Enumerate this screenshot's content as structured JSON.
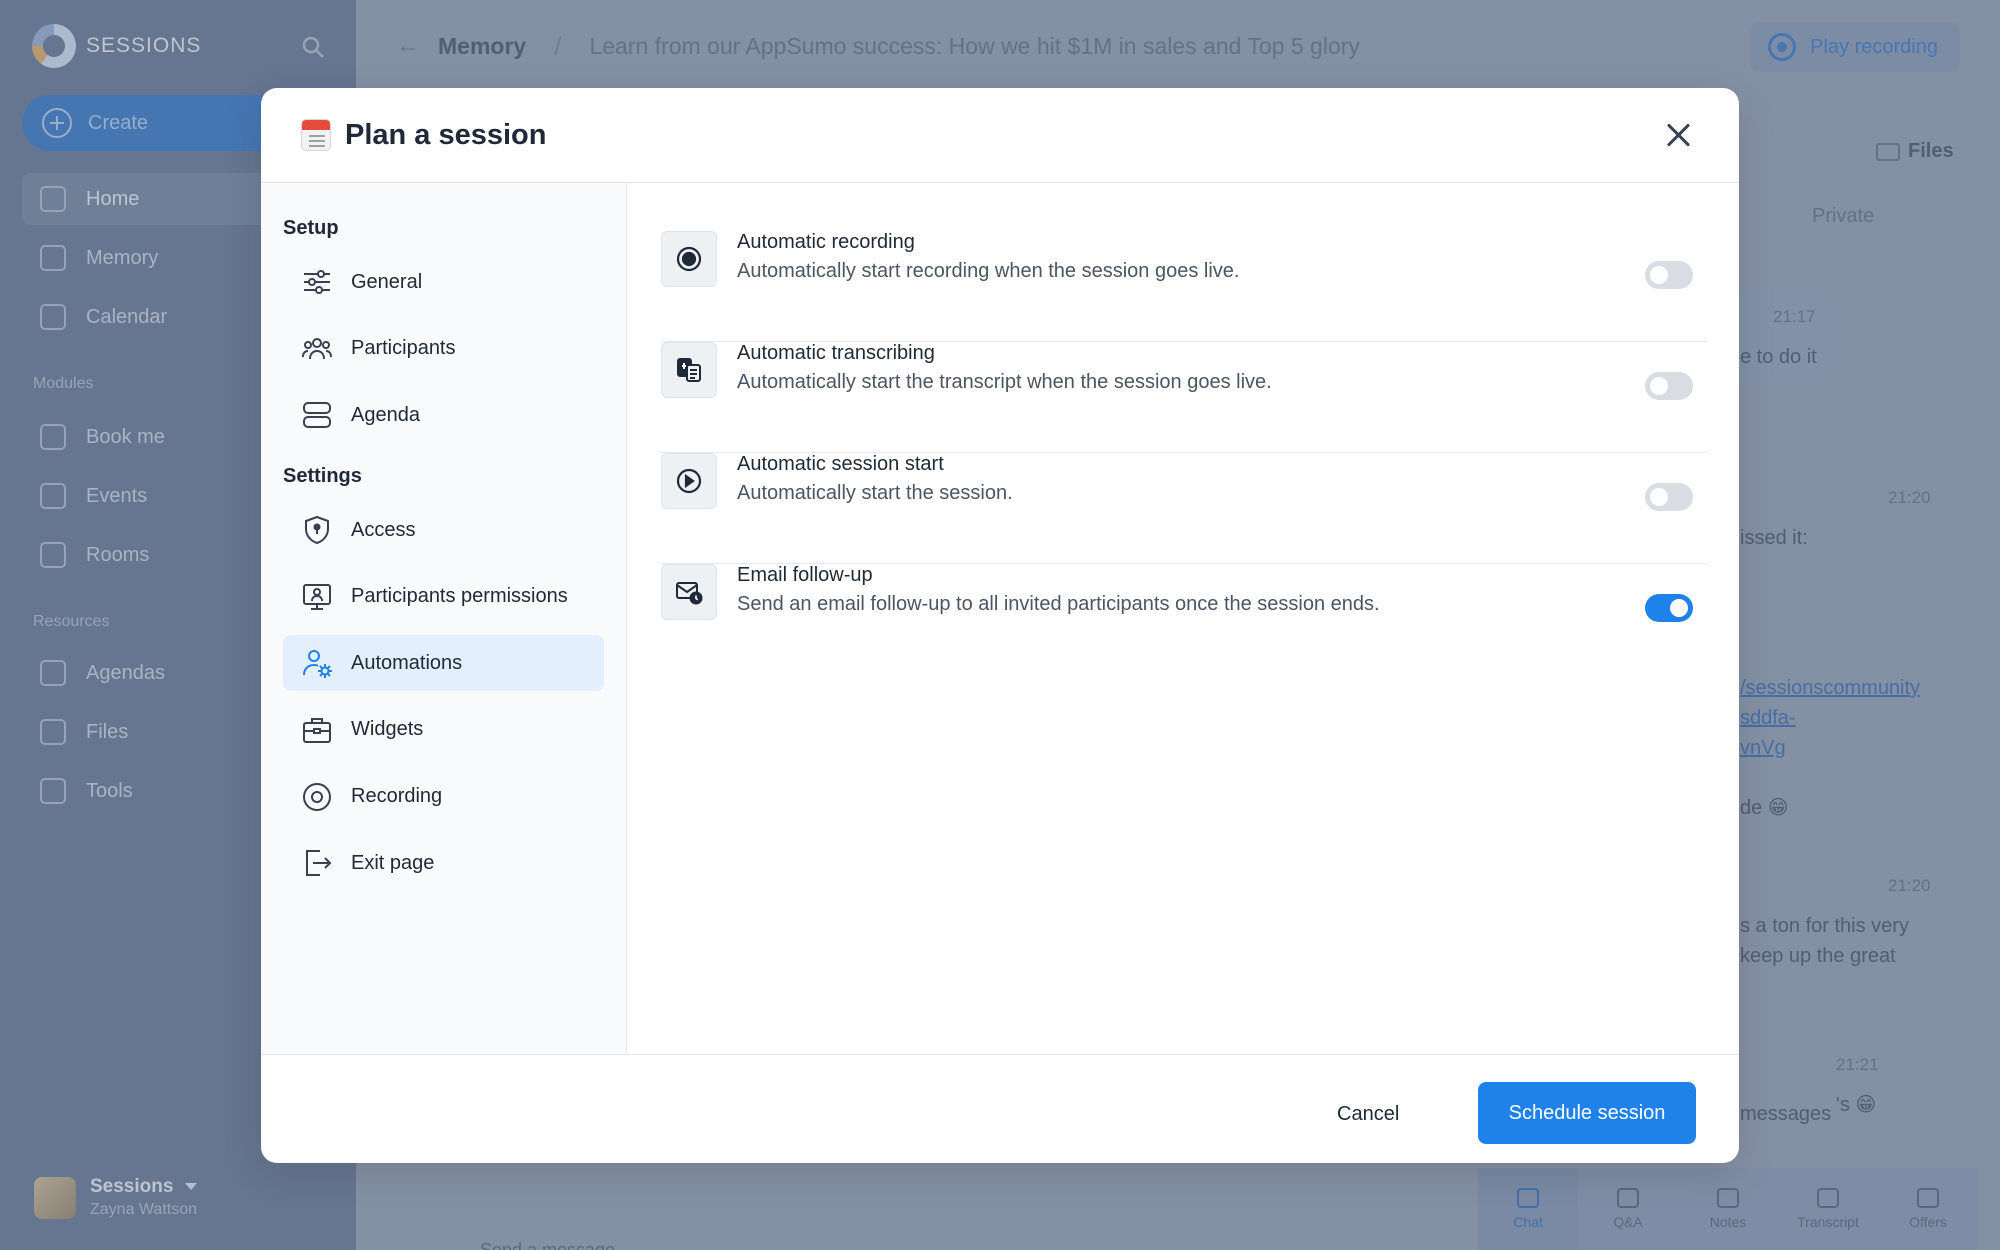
{
  "app": {
    "brand": "SESSIONS",
    "create_label": "Create",
    "nav": {
      "home": "Home",
      "memory": "Memory",
      "calendar": "Calendar",
      "modules_title": "Modules",
      "book_me": "Book me",
      "events": "Events",
      "rooms": "Rooms",
      "resources_title": "Resources",
      "agendas": "Agendas",
      "files": "Files",
      "tools": "Tools"
    },
    "user": {
      "workspace": "Sessions",
      "name": "Zayna Wattson"
    }
  },
  "topbar": {
    "breadcrumb_root": "Memory",
    "breadcrumb_separator": "/",
    "session_title": "Learn from our AppSumo success: How we hit $1M in sales and Top 5 glory",
    "play_recording": "Play recording"
  },
  "right_panel": {
    "files": "Files",
    "private_tab": "Private",
    "messages": [
      {
        "time": "21:17",
        "text": "e to do it"
      },
      {
        "time": "21:20",
        "text": "issed it:",
        "links": [
          "/sessionscommunity",
          "sddfa-",
          "vnVg"
        ],
        "tail": "de 😁"
      },
      {
        "time": "21:20",
        "lines": [
          "s a ton for this very",
          "keep up the great"
        ]
      },
      {
        "time": "21:21",
        "text": "'s 😁"
      }
    ],
    "new_messages": "messages",
    "tabs": [
      "Chat",
      "Q&A",
      "Notes",
      "Transcript",
      "Offers"
    ],
    "active_tab": "Chat",
    "chat_peek": "Send a message"
  },
  "modal": {
    "title": "Plan a session",
    "setup_title": "Setup",
    "settings_title": "Settings",
    "setup_items": [
      {
        "label": "General",
        "icon": "sliders-icon"
      },
      {
        "label": "Participants",
        "icon": "people-icon"
      },
      {
        "label": "Agenda",
        "icon": "agenda-icon"
      }
    ],
    "settings_items": [
      {
        "label": "Access",
        "icon": "shield-icon"
      },
      {
        "label": "Participants permissions",
        "icon": "monitor-user-icon"
      },
      {
        "label": "Automations",
        "icon": "user-gear-icon",
        "active": true
      },
      {
        "label": "Widgets",
        "icon": "briefcase-icon"
      },
      {
        "label": "Recording",
        "icon": "record-icon"
      },
      {
        "label": "Exit page",
        "icon": "exit-icon"
      }
    ],
    "automations": [
      {
        "title": "Automatic recording",
        "description": "Automatically start recording when the session goes live.",
        "enabled": false,
        "icon": "record-icon"
      },
      {
        "title": "Automatic transcribing",
        "description": "Automatically start the transcript when the session goes live.",
        "enabled": false,
        "icon": "transcript-icon"
      },
      {
        "title": "Automatic session start",
        "description": "Automatically start the session.",
        "enabled": false,
        "icon": "play-circle-icon"
      },
      {
        "title": "Email follow-up",
        "description": "Send an email follow-up to all invited participants once the session ends.",
        "enabled": true,
        "icon": "email-clock-icon"
      }
    ],
    "cancel_label": "Cancel",
    "schedule_label": "Schedule session"
  },
  "colors": {
    "accent": "#1f82ea",
    "active_nav_bg": "#e4effd",
    "toggle_off": "#d9dde3",
    "sidebar_bg": "#5c6e8c"
  }
}
